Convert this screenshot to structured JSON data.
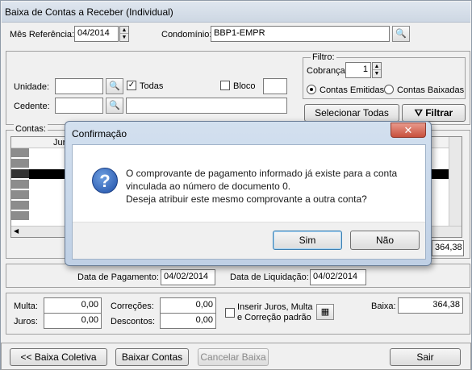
{
  "window": {
    "title": "Baixa de Contas a Receber (Individual)"
  },
  "header": {
    "mes_label": "Mês Referência:",
    "mes_value": "04/2014",
    "condominio_label": "Condomínio:",
    "condominio_value": "BBP1-EMPR"
  },
  "filters": {
    "unidade_label": "Unidade:",
    "unidade_value": "",
    "todas_label": "Todas",
    "todas_checked": true,
    "bloco_label": "Bloco",
    "bloco_value": "",
    "cedente_label": "Cedente:",
    "cedente_value": "",
    "cedente_name": ""
  },
  "filtro": {
    "group_label": "Filtro:",
    "cobranca_label": "Cobrança:",
    "cobranca_value": "1",
    "emitidas_label": "Contas Emitidas",
    "baixadas_label": "Contas Baixadas",
    "selected": "emitidas",
    "selecionar_label": "Selecionar Todas",
    "filtrar_label": "Filtrar"
  },
  "contas": {
    "group_label": "Contas:",
    "columns": [
      "Juro"
    ],
    "total": "364,38"
  },
  "dates": {
    "pagamento_label": "Data de Pagamento:",
    "pagamento_value": "04/02/2014",
    "liquidacao_label": "Data de Liquidação:",
    "liquidacao_value": "04/02/2014"
  },
  "values": {
    "multa_label": "Multa:",
    "multa_value": "0,00",
    "juros_label": "Juros:",
    "juros_value": "0,00",
    "correcoes_label": "Correções:",
    "correcoes_value": "0,00",
    "descontos_label": "Descontos:",
    "descontos_value": "0,00",
    "inserir_line1": "Inserir Juros, Multa",
    "inserir_line2": "e Correção padrão",
    "baixa_label": "Baixa:",
    "baixa_value": "364,38"
  },
  "footer": {
    "baixa_coletiva": "<< Baixa Coletiva",
    "baixar_contas": "Baixar Contas",
    "cancelar_baixa": "Cancelar Baixa",
    "sair": "Sair"
  },
  "dialog": {
    "title": "Confirmação",
    "line1": "O comprovante de pagamento informado já existe para a conta",
    "line2": "vinculada ao número de documento 0.",
    "line3": "Deseja atribuir este mesmo comprovante a outra conta?",
    "yes": "Sim",
    "no": "Não"
  }
}
